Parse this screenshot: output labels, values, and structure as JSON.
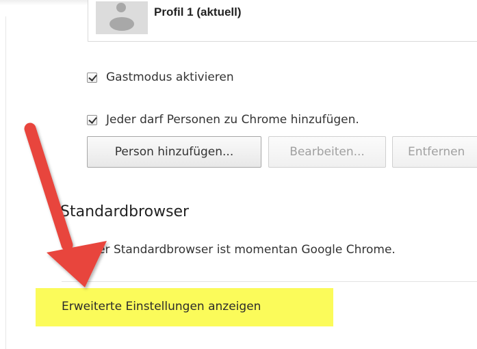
{
  "profile": {
    "name": "Profil 1 (aktuell)",
    "avatar_icon": "default-person-avatar-icon"
  },
  "people_options": [
    {
      "label": "Gastmodus aktivieren",
      "checked": true
    },
    {
      "label": "Jeder darf Personen zu Chrome hinzufügen.",
      "checked": true
    }
  ],
  "buttons": {
    "add_person": "Person hinzufügen...",
    "edit": "Bearbeiten...",
    "remove": "Entfernen"
  },
  "default_browser": {
    "title": "Standardbrowser",
    "status": "Der Standardbrowser ist momentan Google Chrome."
  },
  "advanced": {
    "link": "Erweiterte Einstellungen anzeigen"
  },
  "annotation": {
    "arrow_color": "#e8453c",
    "highlight_color": "#fbfb5a"
  }
}
